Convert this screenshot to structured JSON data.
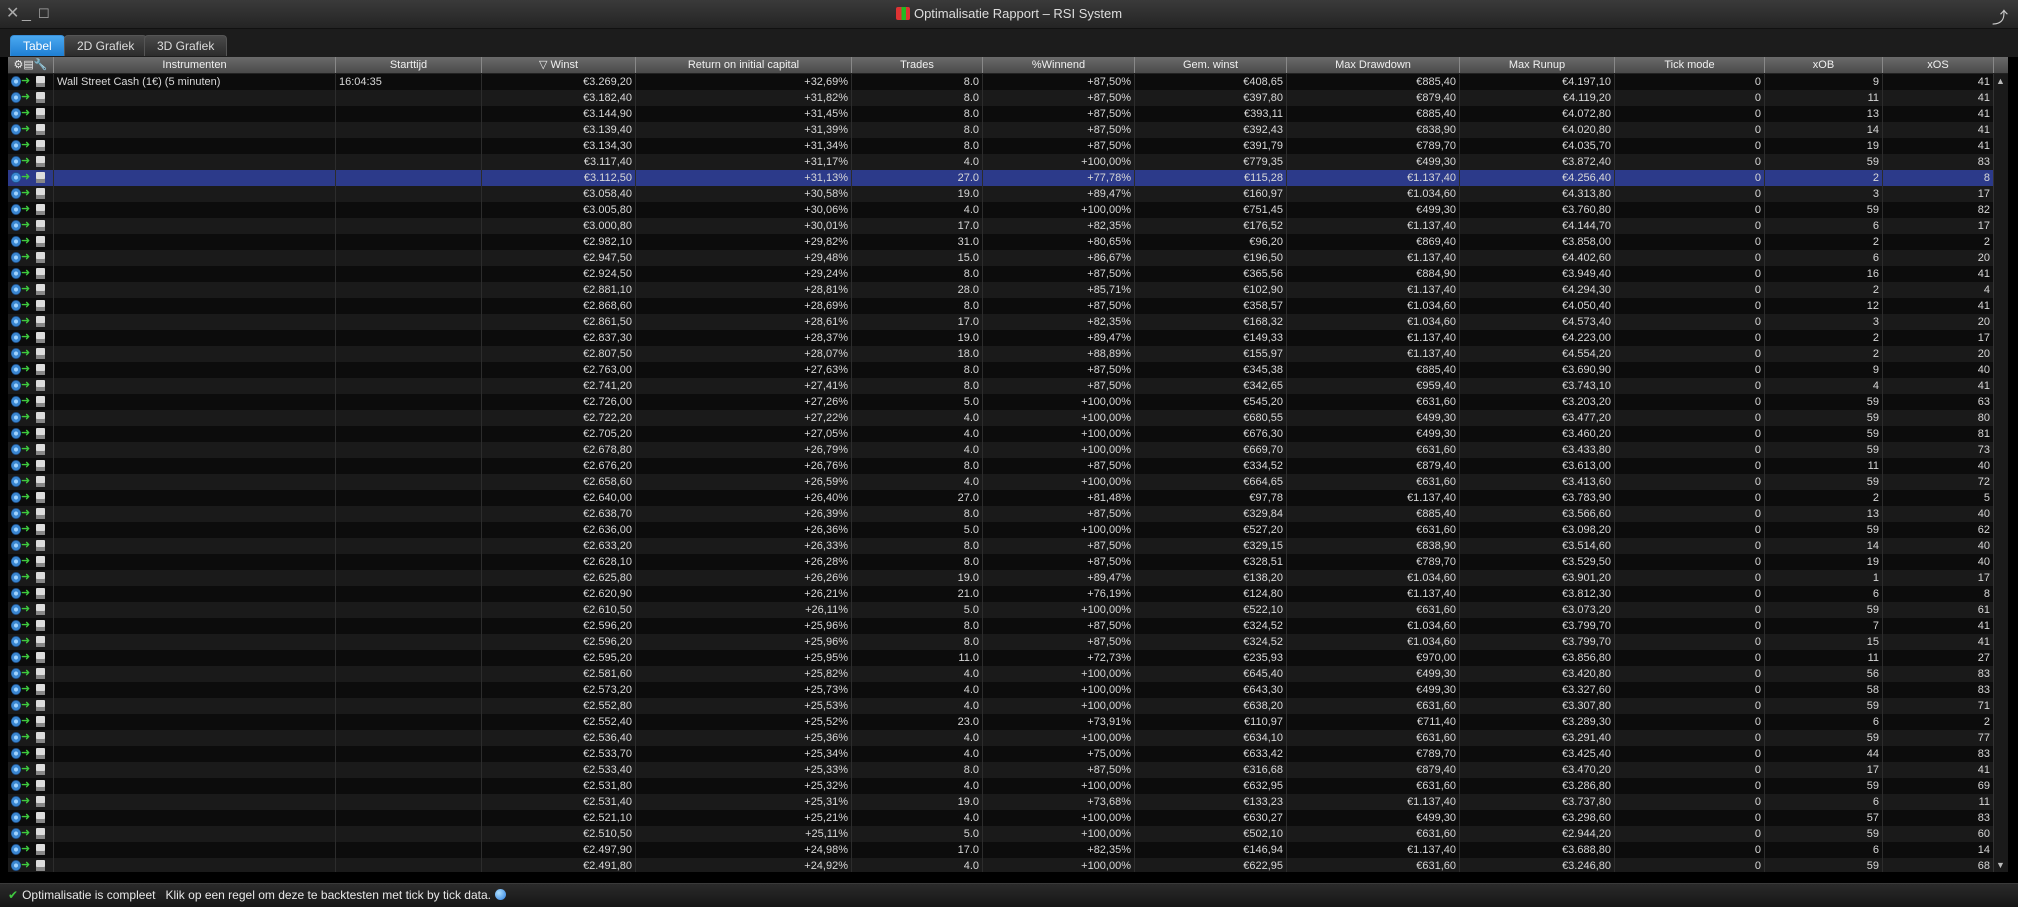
{
  "window": {
    "title": "Optimalisatie Rapport – RSI System"
  },
  "tabs": [
    "Tabel",
    "2D Grafiek",
    "3D Grafiek"
  ],
  "columns": [
    "Instrumenten",
    "Starttijd",
    "Winst",
    "Return on initial capital",
    "Trades",
    "%Winnend",
    "Gem. winst",
    "Max Drawdown",
    "Max Runup",
    "Tick mode",
    "xOB",
    "xOS"
  ],
  "sort_indicator": "▽",
  "first_row": {
    "instrument": "Wall Street Cash (1€) (5 minuten)",
    "start": "16:04:35"
  },
  "selected_row": 6,
  "rows": [
    [
      "€3.269,20",
      "+32,69%",
      "8.0",
      "+87,50%",
      "€408,65",
      "€885,40",
      "€4.197,10",
      "0",
      "9",
      "41"
    ],
    [
      "€3.182,40",
      "+31,82%",
      "8.0",
      "+87,50%",
      "€397,80",
      "€879,40",
      "€4.119,20",
      "0",
      "11",
      "41"
    ],
    [
      "€3.144,90",
      "+31,45%",
      "8.0",
      "+87,50%",
      "€393,11",
      "€885,40",
      "€4.072,80",
      "0",
      "13",
      "41"
    ],
    [
      "€3.139,40",
      "+31,39%",
      "8.0",
      "+87,50%",
      "€392,43",
      "€838,90",
      "€4.020,80",
      "0",
      "14",
      "41"
    ],
    [
      "€3.134,30",
      "+31,34%",
      "8.0",
      "+87,50%",
      "€391,79",
      "€789,70",
      "€4.035,70",
      "0",
      "19",
      "41"
    ],
    [
      "€3.117,40",
      "+31,17%",
      "4.0",
      "+100,00%",
      "€779,35",
      "€499,30",
      "€3.872,40",
      "0",
      "59",
      "83"
    ],
    [
      "€3.112,50",
      "+31,13%",
      "27.0",
      "+77,78%",
      "€115,28",
      "€1.137,40",
      "€4.256,40",
      "0",
      "2",
      "8"
    ],
    [
      "€3.058,40",
      "+30,58%",
      "19.0",
      "+89,47%",
      "€160,97",
      "€1.034,60",
      "€4.313,80",
      "0",
      "3",
      "17"
    ],
    [
      "€3.005,80",
      "+30,06%",
      "4.0",
      "+100,00%",
      "€751,45",
      "€499,30",
      "€3.760,80",
      "0",
      "59",
      "82"
    ],
    [
      "€3.000,80",
      "+30,01%",
      "17.0",
      "+82,35%",
      "€176,52",
      "€1.137,40",
      "€4.144,70",
      "0",
      "6",
      "17"
    ],
    [
      "€2.982,10",
      "+29,82%",
      "31.0",
      "+80,65%",
      "€96,20",
      "€869,40",
      "€3.858,00",
      "0",
      "2",
      "2"
    ],
    [
      "€2.947,50",
      "+29,48%",
      "15.0",
      "+86,67%",
      "€196,50",
      "€1.137,40",
      "€4.402,60",
      "0",
      "6",
      "20"
    ],
    [
      "€2.924,50",
      "+29,24%",
      "8.0",
      "+87,50%",
      "€365,56",
      "€884,90",
      "€3.949,40",
      "0",
      "16",
      "41"
    ],
    [
      "€2.881,10",
      "+28,81%",
      "28.0",
      "+85,71%",
      "€102,90",
      "€1.137,40",
      "€4.294,30",
      "0",
      "2",
      "4"
    ],
    [
      "€2.868,60",
      "+28,69%",
      "8.0",
      "+87,50%",
      "€358,57",
      "€1.034,60",
      "€4.050,40",
      "0",
      "12",
      "41"
    ],
    [
      "€2.861,50",
      "+28,61%",
      "17.0",
      "+82,35%",
      "€168,32",
      "€1.034,60",
      "€4.573,40",
      "0",
      "3",
      "20"
    ],
    [
      "€2.837,30",
      "+28,37%",
      "19.0",
      "+89,47%",
      "€149,33",
      "€1.137,40",
      "€4.223,00",
      "0",
      "2",
      "17"
    ],
    [
      "€2.807,50",
      "+28,07%",
      "18.0",
      "+88,89%",
      "€155,97",
      "€1.137,40",
      "€4.554,20",
      "0",
      "2",
      "20"
    ],
    [
      "€2.763,00",
      "+27,63%",
      "8.0",
      "+87,50%",
      "€345,38",
      "€885,40",
      "€3.690,90",
      "0",
      "9",
      "40"
    ],
    [
      "€2.741,20",
      "+27,41%",
      "8.0",
      "+87,50%",
      "€342,65",
      "€959,40",
      "€3.743,10",
      "0",
      "4",
      "41"
    ],
    [
      "€2.726,00",
      "+27,26%",
      "5.0",
      "+100,00%",
      "€545,20",
      "€631,60",
      "€3.203,20",
      "0",
      "59",
      "63"
    ],
    [
      "€2.722,20",
      "+27,22%",
      "4.0",
      "+100,00%",
      "€680,55",
      "€499,30",
      "€3.477,20",
      "0",
      "59",
      "80"
    ],
    [
      "€2.705,20",
      "+27,05%",
      "4.0",
      "+100,00%",
      "€676,30",
      "€499,30",
      "€3.460,20",
      "0",
      "59",
      "81"
    ],
    [
      "€2.678,80",
      "+26,79%",
      "4.0",
      "+100,00%",
      "€669,70",
      "€631,60",
      "€3.433,80",
      "0",
      "59",
      "73"
    ],
    [
      "€2.676,20",
      "+26,76%",
      "8.0",
      "+87,50%",
      "€334,52",
      "€879,40",
      "€3.613,00",
      "0",
      "11",
      "40"
    ],
    [
      "€2.658,60",
      "+26,59%",
      "4.0",
      "+100,00%",
      "€664,65",
      "€631,60",
      "€3.413,60",
      "0",
      "59",
      "72"
    ],
    [
      "€2.640,00",
      "+26,40%",
      "27.0",
      "+81,48%",
      "€97,78",
      "€1.137,40",
      "€3.783,90",
      "0",
      "2",
      "5"
    ],
    [
      "€2.638,70",
      "+26,39%",
      "8.0",
      "+87,50%",
      "€329,84",
      "€885,40",
      "€3.566,60",
      "0",
      "13",
      "40"
    ],
    [
      "€2.636,00",
      "+26,36%",
      "5.0",
      "+100,00%",
      "€527,20",
      "€631,60",
      "€3.098,20",
      "0",
      "59",
      "62"
    ],
    [
      "€2.633,20",
      "+26,33%",
      "8.0",
      "+87,50%",
      "€329,15",
      "€838,90",
      "€3.514,60",
      "0",
      "14",
      "40"
    ],
    [
      "€2.628,10",
      "+26,28%",
      "8.0",
      "+87,50%",
      "€328,51",
      "€789,70",
      "€3.529,50",
      "0",
      "19",
      "40"
    ],
    [
      "€2.625,80",
      "+26,26%",
      "19.0",
      "+89,47%",
      "€138,20",
      "€1.034,60",
      "€3.901,20",
      "0",
      "1",
      "17"
    ],
    [
      "€2.620,90",
      "+26,21%",
      "21.0",
      "+76,19%",
      "€124,80",
      "€1.137,40",
      "€3.812,30",
      "0",
      "6",
      "8"
    ],
    [
      "€2.610,50",
      "+26,11%",
      "5.0",
      "+100,00%",
      "€522,10",
      "€631,60",
      "€3.073,20",
      "0",
      "59",
      "61"
    ],
    [
      "€2.596,20",
      "+25,96%",
      "8.0",
      "+87,50%",
      "€324,52",
      "€1.034,60",
      "€3.799,70",
      "0",
      "7",
      "41"
    ],
    [
      "€2.596,20",
      "+25,96%",
      "8.0",
      "+87,50%",
      "€324,52",
      "€1.034,60",
      "€3.799,70",
      "0",
      "15",
      "41"
    ],
    [
      "€2.595,20",
      "+25,95%",
      "11.0",
      "+72,73%",
      "€235,93",
      "€970,00",
      "€3.856,80",
      "0",
      "11",
      "27"
    ],
    [
      "€2.581,60",
      "+25,82%",
      "4.0",
      "+100,00%",
      "€645,40",
      "€499,30",
      "€3.420,80",
      "0",
      "56",
      "83"
    ],
    [
      "€2.573,20",
      "+25,73%",
      "4.0",
      "+100,00%",
      "€643,30",
      "€499,30",
      "€3.327,60",
      "0",
      "58",
      "83"
    ],
    [
      "€2.552,80",
      "+25,53%",
      "4.0",
      "+100,00%",
      "€638,20",
      "€631,60",
      "€3.307,80",
      "0",
      "59",
      "71"
    ],
    [
      "€2.552,40",
      "+25,52%",
      "23.0",
      "+73,91%",
      "€110,97",
      "€711,40",
      "€3.289,30",
      "0",
      "6",
      "2"
    ],
    [
      "€2.536,40",
      "+25,36%",
      "4.0",
      "+100,00%",
      "€634,10",
      "€631,60",
      "€3.291,40",
      "0",
      "59",
      "77"
    ],
    [
      "€2.533,70",
      "+25,34%",
      "4.0",
      "+75,00%",
      "€633,42",
      "€789,70",
      "€3.425,40",
      "0",
      "44",
      "83"
    ],
    [
      "€2.533,40",
      "+25,33%",
      "8.0",
      "+87,50%",
      "€316,68",
      "€879,40",
      "€3.470,20",
      "0",
      "17",
      "41"
    ],
    [
      "€2.531,80",
      "+25,32%",
      "4.0",
      "+100,00%",
      "€632,95",
      "€631,60",
      "€3.286,80",
      "0",
      "59",
      "69"
    ],
    [
      "€2.531,40",
      "+25,31%",
      "19.0",
      "+73,68%",
      "€133,23",
      "€1.137,40",
      "€3.737,80",
      "0",
      "6",
      "11"
    ],
    [
      "€2.521,10",
      "+25,21%",
      "4.0",
      "+100,00%",
      "€630,27",
      "€499,30",
      "€3.298,60",
      "0",
      "57",
      "83"
    ],
    [
      "€2.510,50",
      "+25,11%",
      "5.0",
      "+100,00%",
      "€502,10",
      "€631,60",
      "€2.944,20",
      "0",
      "59",
      "60"
    ],
    [
      "€2.497,90",
      "+24,98%",
      "17.0",
      "+82,35%",
      "€146,94",
      "€1.137,40",
      "€3.688,80",
      "0",
      "6",
      "14"
    ],
    [
      "€2.491,80",
      "+24,92%",
      "4.0",
      "+100,00%",
      "€622,95",
      "€631,60",
      "€3.246,80",
      "0",
      "59",
      "68"
    ]
  ],
  "status": {
    "message": "Optimalisatie is compleet",
    "hint": "Klik op een regel om deze te backtesten met tick by tick data."
  },
  "colors": {
    "tab_active": "#2a8fe0",
    "selected_row": "#2c3a8a",
    "status_check": "#40c840"
  }
}
